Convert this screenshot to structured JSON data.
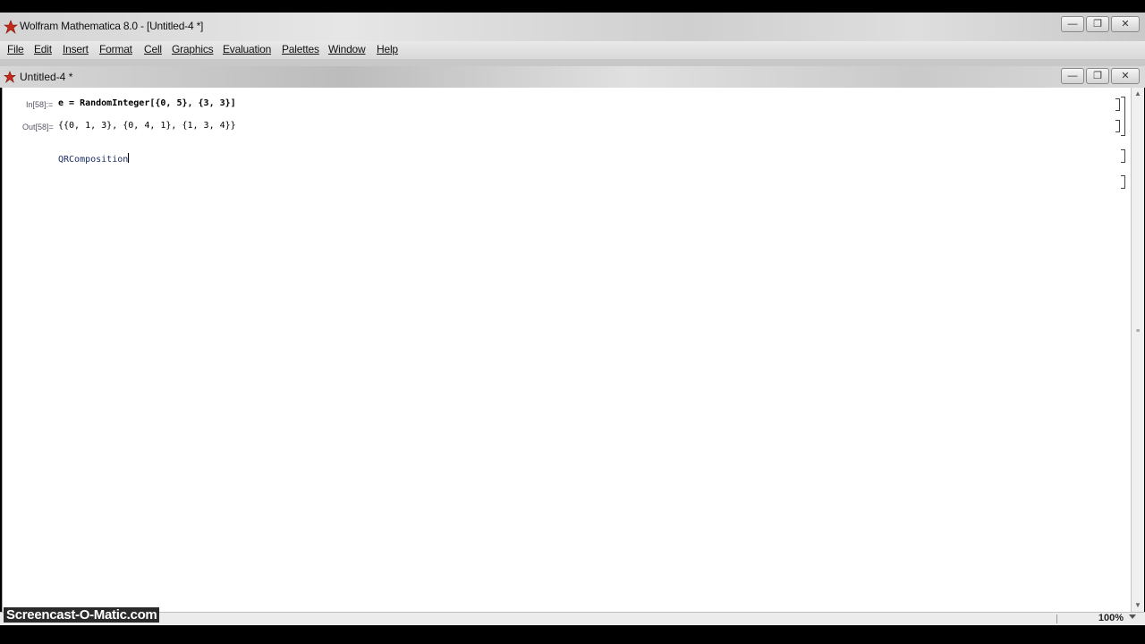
{
  "window": {
    "title": "Wolfram Mathematica 8.0 - [Untitled-4 *]",
    "minimize": "—",
    "maximize": "❐",
    "close": "✕"
  },
  "menu": [
    "File",
    "Edit",
    "Insert",
    "Format",
    "Cell",
    "Graphics",
    "Evaluation",
    "Palettes",
    "Window",
    "Help"
  ],
  "document": {
    "title": "Untitled-4 *"
  },
  "cells": {
    "in_label": "In[58]:=",
    "in_code": "e = RandomInteger[{0, 5}, {3, 3}]",
    "out_label": "Out[58]=",
    "out_code": "{{0, 1, 3}, {0, 4, 1}, {1, 3, 4}}",
    "typing_code": "QRComposition"
  },
  "status": {
    "zoom": "100%"
  },
  "watermark": "Screencast-O-Matic.com"
}
